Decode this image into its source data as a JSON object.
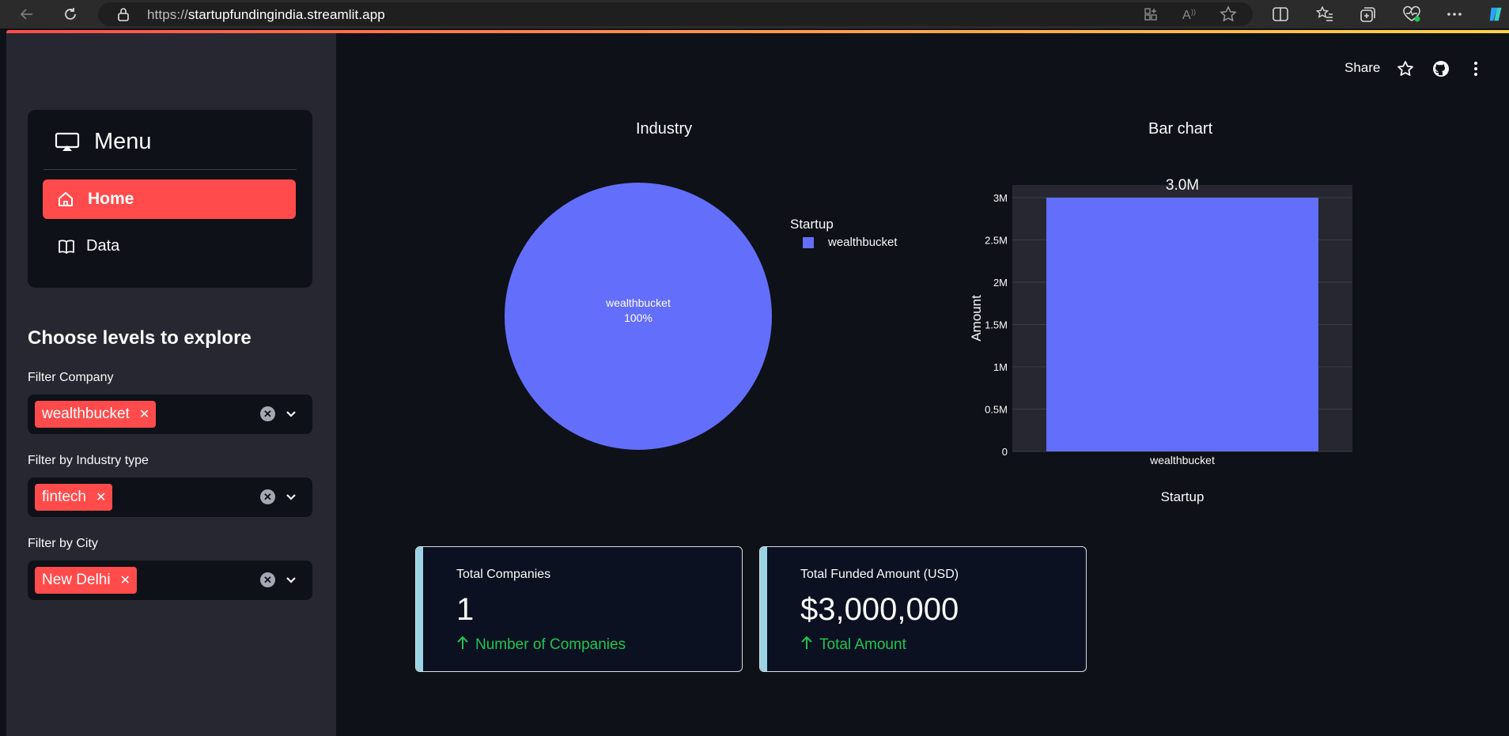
{
  "browser": {
    "url_prefix": "https://",
    "url_host": "startupfundingindia.streamlit.app"
  },
  "sidebar": {
    "menu_title": "Menu",
    "menu_items": [
      {
        "label": "Home",
        "icon": "house-icon",
        "active": true
      },
      {
        "label": "Data",
        "icon": "book-icon",
        "active": false
      }
    ],
    "section_title": "Choose levels to explore",
    "filters": [
      {
        "label": "Filter Company",
        "selected": "wealthbucket"
      },
      {
        "label": "Filter by Industry type",
        "selected": "fintech"
      },
      {
        "label": "Filter by City",
        "selected": "New Delhi"
      }
    ]
  },
  "header": {
    "share_label": "Share",
    "icons": [
      "star-icon",
      "github-icon",
      "kebab-menu-icon"
    ]
  },
  "colors": {
    "accent": "#ff4b4b",
    "series": "#636efa",
    "delta_positive": "#21c354",
    "metric_bar": "#9ad3e3"
  },
  "chart_data": [
    {
      "type": "pie",
      "title": "Industry",
      "legend_title": "Startup",
      "labels": [
        "wealthbucket"
      ],
      "values": [
        100
      ],
      "slice_text": [
        "wealthbucket",
        "100%"
      ],
      "legend_position": "top-right"
    },
    {
      "type": "bar",
      "title": "Bar chart",
      "categories": [
        "wealthbucket"
      ],
      "values": [
        3000000
      ],
      "data_labels": [
        "3.0M"
      ],
      "xlabel": "Startup",
      "ylabel": "Amount",
      "ylim": [
        0,
        3150000
      ],
      "yticks": [
        0,
        500000,
        1000000,
        1500000,
        2000000,
        2500000,
        3000000
      ],
      "ytick_labels": [
        "0",
        "0.5M",
        "1M",
        "1.5M",
        "2M",
        "2.5M",
        "3M"
      ],
      "grid": true
    }
  ],
  "metrics": [
    {
      "label": "Total Companies",
      "value": "1",
      "delta": "Number of Companies"
    },
    {
      "label": "Total Funded Amount (USD)",
      "value": "$3,000,000",
      "delta": "Total Amount"
    }
  ]
}
